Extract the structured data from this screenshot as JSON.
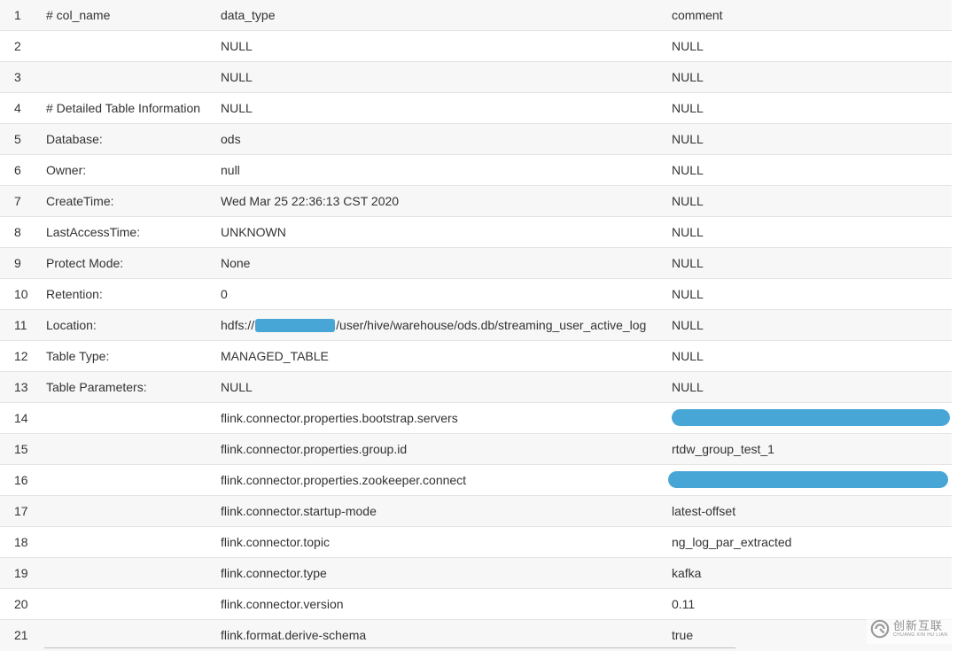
{
  "rows": [
    {
      "num": "1",
      "col_name": "# col_name",
      "data_type": "data_type",
      "comment": "comment"
    },
    {
      "num": "2",
      "col_name": "",
      "data_type": "NULL",
      "comment": "NULL"
    },
    {
      "num": "3",
      "col_name": "",
      "data_type": "NULL",
      "comment": "NULL"
    },
    {
      "num": "4",
      "col_name": "# Detailed Table Information",
      "data_type": "NULL",
      "comment": "NULL"
    },
    {
      "num": "5",
      "col_name": "Database:",
      "data_type": "ods",
      "comment": "NULL"
    },
    {
      "num": "6",
      "col_name": "Owner:",
      "data_type": "null",
      "comment": "NULL"
    },
    {
      "num": "7",
      "col_name": "CreateTime:",
      "data_type": "Wed Mar 25 22:36:13 CST 2020",
      "comment": "NULL"
    },
    {
      "num": "8",
      "col_name": "LastAccessTime:",
      "data_type": "UNKNOWN",
      "comment": "NULL"
    },
    {
      "num": "9",
      "col_name": "Protect Mode:",
      "data_type": "None",
      "comment": "NULL"
    },
    {
      "num": "10",
      "col_name": "Retention:",
      "data_type": "0",
      "comment": "NULL"
    },
    {
      "num": "11",
      "col_name": "Location:",
      "data_type_prefix": "hdfs://",
      "data_type_suffix": "/user/hive/warehouse/ods.db/streaming_user_active_log",
      "comment": "NULL"
    },
    {
      "num": "12",
      "col_name": "Table Type:",
      "data_type": "MANAGED_TABLE",
      "comment": "NULL"
    },
    {
      "num": "13",
      "col_name": "Table Parameters:",
      "data_type": "NULL",
      "comment": "NULL"
    },
    {
      "num": "14",
      "col_name": "",
      "data_type": "flink.connector.properties.bootstrap.servers",
      "comment": ""
    },
    {
      "num": "15",
      "col_name": "",
      "data_type": "flink.connector.properties.group.id",
      "comment": "rtdw_group_test_1"
    },
    {
      "num": "16",
      "col_name": "",
      "data_type": "flink.connector.properties.zookeeper.connect",
      "comment": ""
    },
    {
      "num": "17",
      "col_name": "",
      "data_type": "flink.connector.startup-mode",
      "comment": "latest-offset"
    },
    {
      "num": "18",
      "col_name": "",
      "data_type": "flink.connector.topic",
      "comment": "ng_log_par_extracted"
    },
    {
      "num": "19",
      "col_name": "",
      "data_type": "flink.connector.type",
      "comment": "kafka"
    },
    {
      "num": "20",
      "col_name": "",
      "data_type": "flink.connector.version",
      "comment": "0.11"
    },
    {
      "num": "21",
      "col_name": "",
      "data_type": "flink.format.derive-schema",
      "comment": "true"
    }
  ],
  "watermark": {
    "cn": "创新互联",
    "en": "CHUANG XIN HU LIAN",
    "icon": "swirl-logo-icon"
  },
  "colors": {
    "redaction": "#48a6d6",
    "odd_row": "#f7f7f7",
    "text": "#333333"
  }
}
